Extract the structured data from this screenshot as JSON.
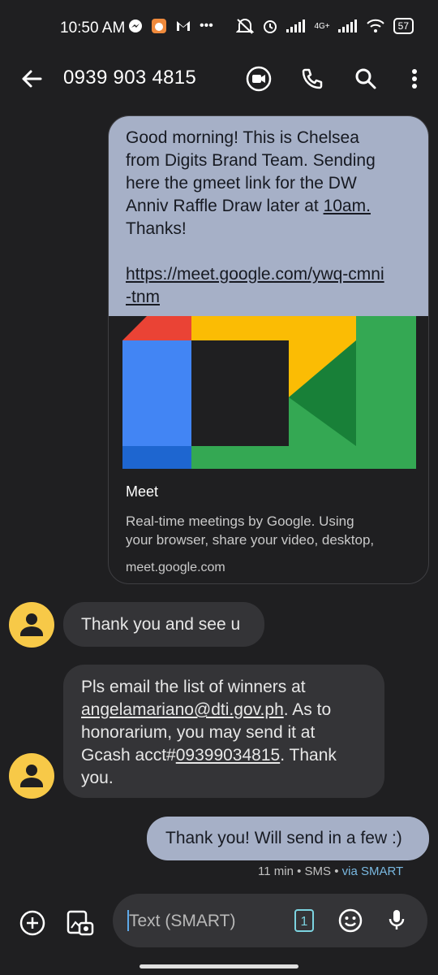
{
  "status_bar": {
    "time": "10:50 AM",
    "network": "4G+",
    "battery": "57"
  },
  "app_bar": {
    "contact": "0939 903 4815"
  },
  "messages": {
    "m1": {
      "lines": [
        "Good morning! This is Chelsea",
        "from Digits Brand Team. Sending",
        "here the gmeet link for the DW",
        "Anniv Raffle Draw later at "
      ],
      "time_link": "10am.",
      "thanks": "Thanks!",
      "link_line1": "https://meet.google.com/ywq-cmni",
      "link_line2": "-tnm",
      "preview_title": "Meet",
      "preview_desc_1": "Real-time meetings by Google. Using",
      "preview_desc_2": "your browser, share your video, desktop,",
      "preview_domain": "meet.google.com"
    },
    "m2": {
      "text": "Thank you and see u"
    },
    "m3": {
      "line1": "Pls email the list of winners at",
      "email": "angelamariano@dti.gov.ph",
      "line2_tail": ". As to",
      "line3": "honorarium, you may send it at",
      "line4_head": "Gcash acct#",
      "acct": "09399034815",
      "line4_tail": ". Thank",
      "line5": "you."
    },
    "m4": {
      "text": "Thank you! Will send in a few :)"
    },
    "m4_status": {
      "time": "11 min",
      "sep1": " • ",
      "type": "SMS",
      "sep2": " • ",
      "via": "via SMART"
    }
  },
  "composer": {
    "placeholder": "Text (SMART)",
    "sim_badge": "1"
  },
  "colors": {
    "background": "#1f1f21",
    "outgoing_bubble": "#a6b0c7",
    "incoming_bubble": "#343437",
    "avatar": "#f7c948",
    "via_link": "#79b8e0"
  }
}
